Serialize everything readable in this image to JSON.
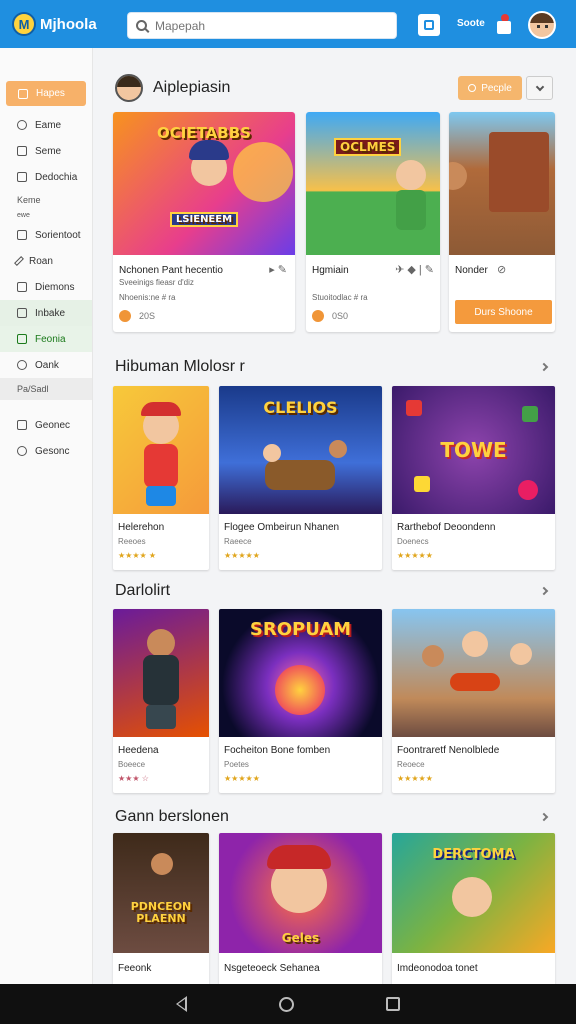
{
  "app": {
    "logo_text": "Mjhoola",
    "logo_glyph": "M"
  },
  "search": {
    "placeholder": "Mapepah"
  },
  "topbar": {
    "link_label": "Soote"
  },
  "sidebar": {
    "items": [
      {
        "label": "Hapes",
        "icon": "home-icon"
      },
      {
        "label": "Eame",
        "icon": "clock-icon"
      },
      {
        "label": "Seme",
        "icon": "grid-icon"
      },
      {
        "label": "Dedochia",
        "icon": "document-icon"
      }
    ],
    "caption": "Keme",
    "caption2": "ewe",
    "items2": [
      {
        "label": "Sorientoot",
        "icon": "list-icon"
      },
      {
        "label": "Roan",
        "icon": "pencil-icon"
      },
      {
        "label": "Diemons",
        "icon": "table-icon"
      },
      {
        "label": "Inbake",
        "icon": "tag-icon"
      },
      {
        "label": "Feonia",
        "icon": "plus-icon"
      },
      {
        "label": "Oank",
        "icon": "refresh-icon"
      },
      {
        "label": "Pa/Sadl",
        "icon": ""
      },
      {
        "label": "Geonec",
        "icon": "bookmark-icon"
      },
      {
        "label": "Gesonc",
        "icon": "settings-icon"
      }
    ]
  },
  "profile": {
    "name": "Aiplepiasin",
    "people_label": "Pecple"
  },
  "featured": [
    {
      "title": "Nchonen Pant hecentio",
      "sub": "Sveeinigs fieasr d'diz",
      "sub2": "Nhoenis:ne # ra",
      "stat": "20S",
      "icons": "▸ ✎"
    },
    {
      "title": "Hgmiain",
      "sub": "Stuoitodlac # ra",
      "stat": "0S0",
      "icons": "✈ ◆ | ✎"
    },
    {
      "title": "Nonder",
      "sub": "",
      "button": "Durs Shoone",
      "icons": "⊘"
    }
  ],
  "sections": [
    {
      "title": "Hibuman Mlolosr r",
      "games": [
        {
          "title": "Helerehon",
          "sub": "Reeoes",
          "stars": "★★★★ ★",
          "img_text": ""
        },
        {
          "title": "Flogee Ombeirun Nhanen",
          "sub": "Raeece",
          "stars": "★★★★★",
          "img_text": "CLELIOS"
        },
        {
          "title": "Rarthebof Deoondenn",
          "sub": "Doenecs",
          "stars": "★★★★★",
          "img_text": "TOWE"
        }
      ]
    },
    {
      "title": "Darlolirt",
      "games": [
        {
          "title": "Heedena",
          "sub": "Boeece",
          "stars": "★★★ ☆",
          "img_text": ""
        },
        {
          "title": "Focheiton Bone fomben",
          "sub": "Poetes",
          "stars": "★★★★★",
          "img_text": "SROPUAM"
        },
        {
          "title": "Foontraretf Nenolblede",
          "sub": "Reoece",
          "stars": "★★★★★",
          "img_text": ""
        }
      ]
    },
    {
      "title": "Gann berslonen",
      "games": [
        {
          "title": "Feeonk",
          "sub": "",
          "stars": "",
          "img_text": "PDNCEON PLAENN"
        },
        {
          "title": "Nsgeteoeck Sehanea",
          "sub": "",
          "stars": "",
          "img_text": "Geles"
        },
        {
          "title": "Imdeonodoa tonet",
          "sub": "",
          "stars": "",
          "img_text": "DERCTOMA"
        }
      ]
    }
  ],
  "featured_images": [
    {
      "img_text": "OCIETABBS",
      "img_sub": "LSIENEEM"
    },
    {
      "img_text": "OCLMES",
      "img_sub": ""
    }
  ],
  "colors": {
    "topbar": "#1f8fe0",
    "accent": "#f49a3d",
    "star": "#e0a51c"
  }
}
